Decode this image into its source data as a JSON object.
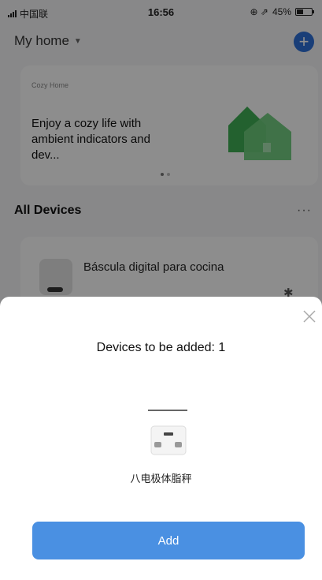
{
  "status_bar": {
    "carrier": "中国联",
    "time": "16:56",
    "indicators": "⊕ ⇗",
    "battery_text": "45%",
    "battery_level": 0.45
  },
  "header": {
    "home_name": "My home",
    "dropdown_icon": "caret-down-icon",
    "add_icon": "plus-circle-icon"
  },
  "banner": {
    "tag": "Cozy Home",
    "headline": "Enjoy a cozy life with ambient indicators and dev..."
  },
  "devices_section": {
    "title": "All Devices",
    "more_label": "···"
  },
  "device_card": {
    "name": "Báscula digital para cocina",
    "connection_icon": "bluetooth-off-icon"
  },
  "sheet": {
    "title": "Devices to be added: 1",
    "device_label": "八电极体脂秤",
    "add_label": "Add"
  },
  "colors": {
    "accent": "#4a90e2",
    "add_circle": "#2d6fd6",
    "house_green": "#5cc06c"
  }
}
